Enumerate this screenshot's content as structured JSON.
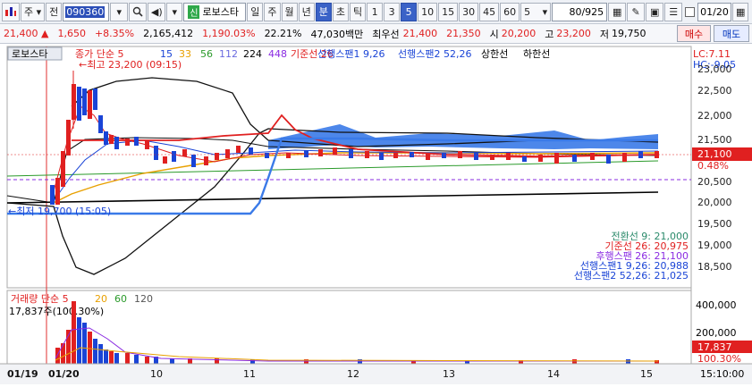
{
  "toolbar": {
    "market_label": "주",
    "prev_label": "전",
    "stock_code": "090360",
    "badge_label": "신",
    "stock_name": "로보스타",
    "period_buttons": [
      "일",
      "주",
      "월",
      "년",
      "분",
      "초",
      "틱"
    ],
    "selected_period": "분",
    "interval_buttons": [
      "1",
      "3",
      "5",
      "10",
      "15",
      "30",
      "45",
      "60"
    ],
    "selected_interval": "5",
    "interval_select": "5",
    "count": "80/925",
    "date_value": "01/20"
  },
  "quote": {
    "price": "21,400",
    "change": "1,650",
    "change_pct": "+8.35%",
    "volume": "2,165,412",
    "volume_ratio": "1,190.03%",
    "turnover": "22.21%",
    "amount": "47,030백만",
    "best_ask_label": "최우선",
    "best_ask": "21,400",
    "best_bid": "21,350",
    "open_label": "시",
    "open": "20,200",
    "high_label": "고",
    "high": "23,200",
    "low_label": "저",
    "low": "19,750",
    "buy_label": "매수",
    "sell_label": "매도"
  },
  "chart": {
    "stock_tag": "로보스타",
    "legend": [
      {
        "text": "종가 단순 5",
        "color": "#e02020"
      },
      {
        "text": "15",
        "color": "#1a44d6"
      },
      {
        "text": "33",
        "color": "#e8a000"
      },
      {
        "text": "56",
        "color": "#2a9a2a"
      },
      {
        "text": "112",
        "color": "#6a6adf"
      },
      {
        "text": "224",
        "color": "#000000"
      },
      {
        "text": "448",
        "color": "#8a2be2"
      },
      {
        "text": "기준선 26",
        "color": "#e02020"
      },
      {
        "text": "선행스팬1 9,26",
        "color": "#1a44d6"
      },
      {
        "text": "선행스팬2 52,26",
        "color": "#1a44d6"
      },
      {
        "text": "상한선",
        "color": "#000000"
      },
      {
        "text": "하한선",
        "color": "#000000"
      }
    ],
    "lc": "LC:7.11",
    "hc": "HC:-9.05",
    "max_label": "최고 23,200 (09:15)",
    "min_label": "최저 19,700 (15:05)",
    "y_ticks": [
      "22,500",
      "22,000",
      "21,500",
      "20,500",
      "20,000",
      "19,500",
      "19,000",
      "18,500"
    ],
    "y_top": "23,000",
    "current_price_tag": "21,100",
    "current_pct_tag": "0.48%",
    "indicators": [
      {
        "text": "전환선 9: 21,000",
        "color": "#2a8a6a"
      },
      {
        "text": "기준선 26: 20,975",
        "color": "#e02020"
      },
      {
        "text": "후행스팬 26: 21,100",
        "color": "#8a2be2"
      },
      {
        "text": "선행스팬1 9,26: 20,988",
        "color": "#1a44d6"
      },
      {
        "text": "선행스팬2 52,26: 21,025",
        "color": "#1a44d6"
      }
    ]
  },
  "volume": {
    "legend": [
      {
        "text": "거래량 단순 5",
        "color": "#e02020"
      },
      {
        "text": "20",
        "color": "#e8a000"
      },
      {
        "text": "60",
        "color": "#2a9a2a"
      },
      {
        "text": "120",
        "color": "#555555"
      }
    ],
    "latest": "17,837주(100.30%)",
    "y_ticks": [
      "400,000",
      "200,000"
    ],
    "current_tag": "17,837",
    "current_pct": "100.30%"
  },
  "x_axis": {
    "labels": [
      "01/19",
      "01/20",
      "10",
      "11",
      "12",
      "13",
      "14",
      "15"
    ],
    "time": "15:10:00"
  }
}
